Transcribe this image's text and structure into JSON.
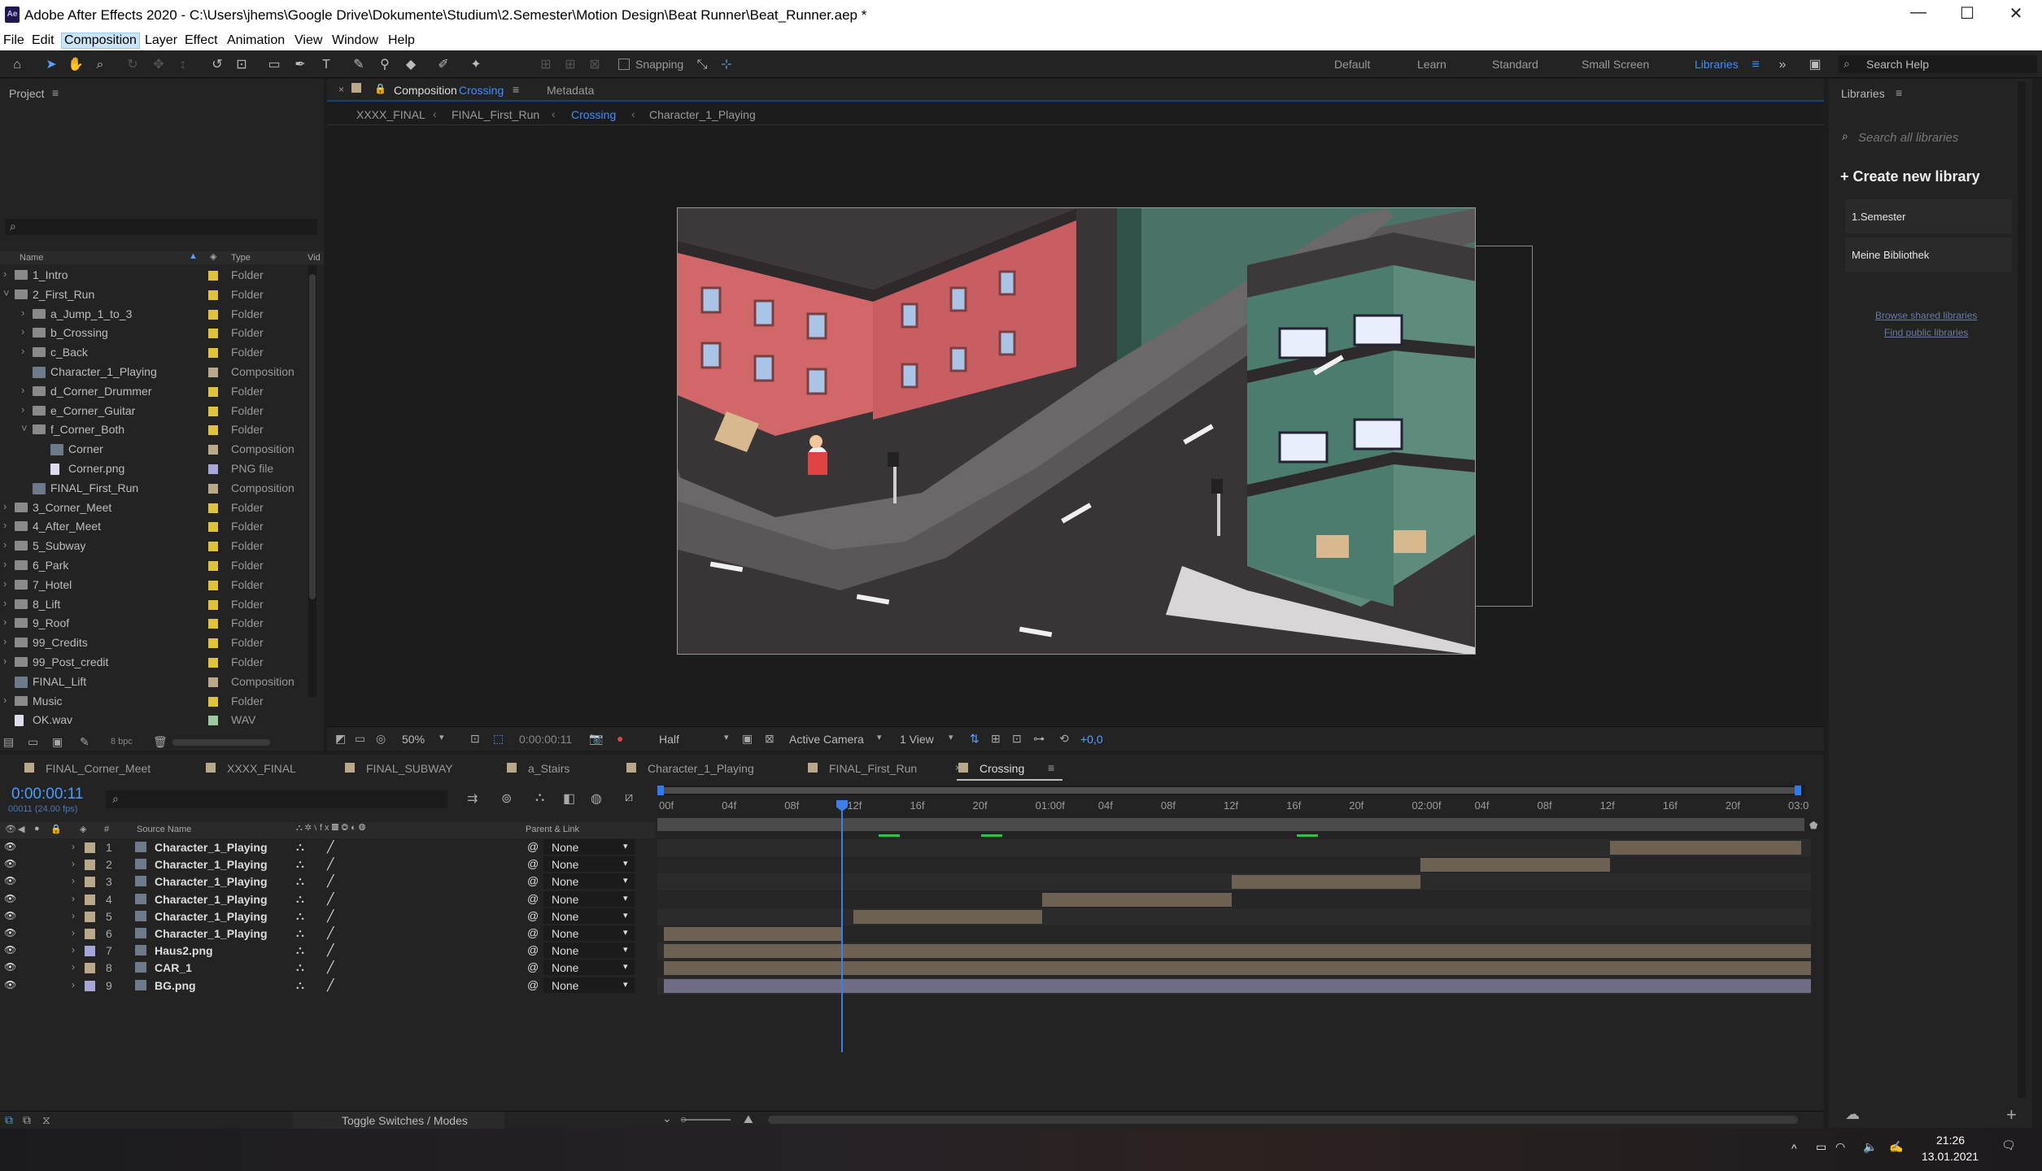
{
  "titlebar": {
    "title": "Adobe After Effects 2020 - C:\\Users\\jhems\\Google Drive\\Dokumente\\Studium\\2.Semester\\Motion Design\\Beat Runner\\Beat_Runner.aep *",
    "logo": "Ae",
    "min": "—",
    "max": "☐",
    "close": "✕"
  },
  "menu": [
    "File",
    "Edit",
    "Composition",
    "Layer",
    "Effect",
    "Animation",
    "View",
    "Window",
    "Help"
  ],
  "toolbar": {
    "snapping": "Snapping",
    "workspaces": [
      "Default",
      "Learn",
      "Standard",
      "Small Screen",
      "Libraries"
    ],
    "search_help": "Search Help"
  },
  "project": {
    "title": "Project",
    "columns": {
      "name": "Name",
      "type": "Type",
      "vid": "Vid"
    },
    "bpc": "8 bpc",
    "items": [
      {
        "name": "1_Intro",
        "type": "Folder",
        "tag": "#e0c23c",
        "indent": 0,
        "twirl": "›",
        "icon": "folder"
      },
      {
        "name": "2_First_Run",
        "type": "Folder",
        "tag": "#e0c23c",
        "indent": 0,
        "twirl": "˅",
        "icon": "folder"
      },
      {
        "name": "a_Jump_1_to_3",
        "type": "Folder",
        "tag": "#e0c23c",
        "indent": 1,
        "twirl": "›",
        "icon": "folder"
      },
      {
        "name": "b_Crossing",
        "type": "Folder",
        "tag": "#e0c23c",
        "indent": 1,
        "twirl": "›",
        "icon": "folder"
      },
      {
        "name": "c_Back",
        "type": "Folder",
        "tag": "#e0c23c",
        "indent": 1,
        "twirl": "›",
        "icon": "folder"
      },
      {
        "name": "Character_1_Playing",
        "type": "Composition",
        "tag": "#b9a98a",
        "indent": 1,
        "twirl": "",
        "icon": "comp"
      },
      {
        "name": "d_Corner_Drummer",
        "type": "Folder",
        "tag": "#e0c23c",
        "indent": 1,
        "twirl": "›",
        "icon": "folder"
      },
      {
        "name": "e_Corner_Guitar",
        "type": "Folder",
        "tag": "#e0c23c",
        "indent": 1,
        "twirl": "›",
        "icon": "folder"
      },
      {
        "name": "f_Corner_Both",
        "type": "Folder",
        "tag": "#e0c23c",
        "indent": 1,
        "twirl": "˅",
        "icon": "folder"
      },
      {
        "name": "Corner",
        "type": "Composition",
        "tag": "#b9a98a",
        "indent": 2,
        "twirl": "",
        "icon": "comp"
      },
      {
        "name": "Corner.png",
        "type": "PNG file",
        "tag": "#a6a6d8",
        "indent": 2,
        "twirl": "",
        "icon": "file"
      },
      {
        "name": "FINAL_First_Run",
        "type": "Composition",
        "tag": "#b9a98a",
        "indent": 1,
        "twirl": "",
        "icon": "comp"
      },
      {
        "name": "3_Corner_Meet",
        "type": "Folder",
        "tag": "#e0c23c",
        "indent": 0,
        "twirl": "›",
        "icon": "folder"
      },
      {
        "name": "4_After_Meet",
        "type": "Folder",
        "tag": "#e0c23c",
        "indent": 0,
        "twirl": "›",
        "icon": "folder"
      },
      {
        "name": "5_Subway",
        "type": "Folder",
        "tag": "#e0c23c",
        "indent": 0,
        "twirl": "›",
        "icon": "folder"
      },
      {
        "name": "6_Park",
        "type": "Folder",
        "tag": "#e0c23c",
        "indent": 0,
        "twirl": "›",
        "icon": "folder"
      },
      {
        "name": "7_Hotel",
        "type": "Folder",
        "tag": "#e0c23c",
        "indent": 0,
        "twirl": "›",
        "icon": "folder"
      },
      {
        "name": "8_Lift",
        "type": "Folder",
        "tag": "#e0c23c",
        "indent": 0,
        "twirl": "›",
        "icon": "folder"
      },
      {
        "name": "9_Roof",
        "type": "Folder",
        "tag": "#e0c23c",
        "indent": 0,
        "twirl": "›",
        "icon": "folder"
      },
      {
        "name": "99_Credits",
        "type": "Folder",
        "tag": "#e0c23c",
        "indent": 0,
        "twirl": "›",
        "icon": "folder"
      },
      {
        "name": "99_Post_credit",
        "type": "Folder",
        "tag": "#e0c23c",
        "indent": 0,
        "twirl": "›",
        "icon": "folder"
      },
      {
        "name": "FINAL_Lift",
        "type": "Composition",
        "tag": "#b9a98a",
        "indent": 0,
        "twirl": "",
        "icon": "comp"
      },
      {
        "name": "Music",
        "type": "Folder",
        "tag": "#e0c23c",
        "indent": 0,
        "twirl": "›",
        "icon": "folder"
      },
      {
        "name": "OK.wav",
        "type": "WAV",
        "tag": "#9ec99e",
        "indent": 0,
        "twirl": "",
        "icon": "file"
      }
    ]
  },
  "comp": {
    "panel_prefix": "Composition",
    "panel_name": "Crossing",
    "metadata_tab": "Metadata",
    "breadcrumbs": [
      "XXXX_FINAL",
      "FINAL_First_Run",
      "Crossing",
      "Character_1_Playing"
    ],
    "zoom": "50%",
    "time": "0:00:00:11",
    "resolution": "Half",
    "camera": "Active Camera",
    "views": "1 View",
    "exposure": "+0,0"
  },
  "libraries": {
    "title": "Libraries",
    "search_placeholder": "Search all libraries",
    "create": "Create new library",
    "items": [
      "1.Semester",
      "Meine Bibliothek"
    ],
    "browse": "Browse shared libraries",
    "find": "Find public libraries"
  },
  "timeline": {
    "tabs": [
      "FINAL_Corner_Meet",
      "XXXX_FINAL",
      "FINAL_SUBWAY",
      "a_Stairs",
      "Character_1_Playing",
      "FINAL_First_Run",
      "Crossing"
    ],
    "timecode": "0:00:00:11",
    "fps": "00011 (24.00 fps)",
    "col_source": "Source Name",
    "col_parent": "Parent & Link",
    "col_num": "#",
    "ticks": [
      "00f",
      "04f",
      "08f",
      "12f",
      "16f",
      "20f",
      "01:00f",
      "04f",
      "08f",
      "12f",
      "16f",
      "20f",
      "02:00f",
      "04f",
      "08f",
      "12f",
      "16f",
      "20f",
      "03:0"
    ],
    "layers": [
      {
        "num": "1",
        "name": "Character_1_Playing",
        "parent": "None",
        "color": "#b9a98a",
        "start": 0.8247,
        "end": 0.9918,
        "bar": "#6c6153"
      },
      {
        "num": "2",
        "name": "Character_1_Playing",
        "parent": "None",
        "color": "#b9a98a",
        "start": 0.6598,
        "end": 0.8247,
        "bar": "#6c6153"
      },
      {
        "num": "3",
        "name": "Character_1_Playing",
        "parent": "None",
        "color": "#b9a98a",
        "start": 0.4948,
        "end": 0.6598,
        "bar": "#6c6153"
      },
      {
        "num": "4",
        "name": "Character_1_Playing",
        "parent": "None",
        "color": "#b9a98a",
        "start": 0.3299,
        "end": 0.4948,
        "bar": "#6c6153"
      },
      {
        "num": "5",
        "name": "Character_1_Playing",
        "parent": "None",
        "color": "#b9a98a",
        "start": 0.1649,
        "end": 0.3299,
        "bar": "#6c6153"
      },
      {
        "num": "6",
        "name": "Character_1_Playing",
        "parent": "None",
        "color": "#b9a98a",
        "start": 0.0,
        "end": 0.1546,
        "bar": "#6c6153"
      },
      {
        "num": "7",
        "name": "Haus2.png",
        "parent": "None",
        "color": "#a6a6d8",
        "start": 0.0,
        "end": 1.0,
        "bar": "#6c6153"
      },
      {
        "num": "8",
        "name": "CAR_1",
        "parent": "None",
        "color": "#b9a98a",
        "start": 0.0,
        "end": 1.0,
        "bar": "#6c6153"
      },
      {
        "num": "9",
        "name": "BG.png",
        "parent": "None",
        "color": "#a6a6d8",
        "start": 0.0,
        "end": 1.0,
        "bar": "#6e6d86"
      }
    ],
    "toggle": "Toggle Switches / Modes",
    "playhead": 0.1546
  },
  "taskbar": {
    "time": "21:26",
    "date": "13.01.2021"
  }
}
